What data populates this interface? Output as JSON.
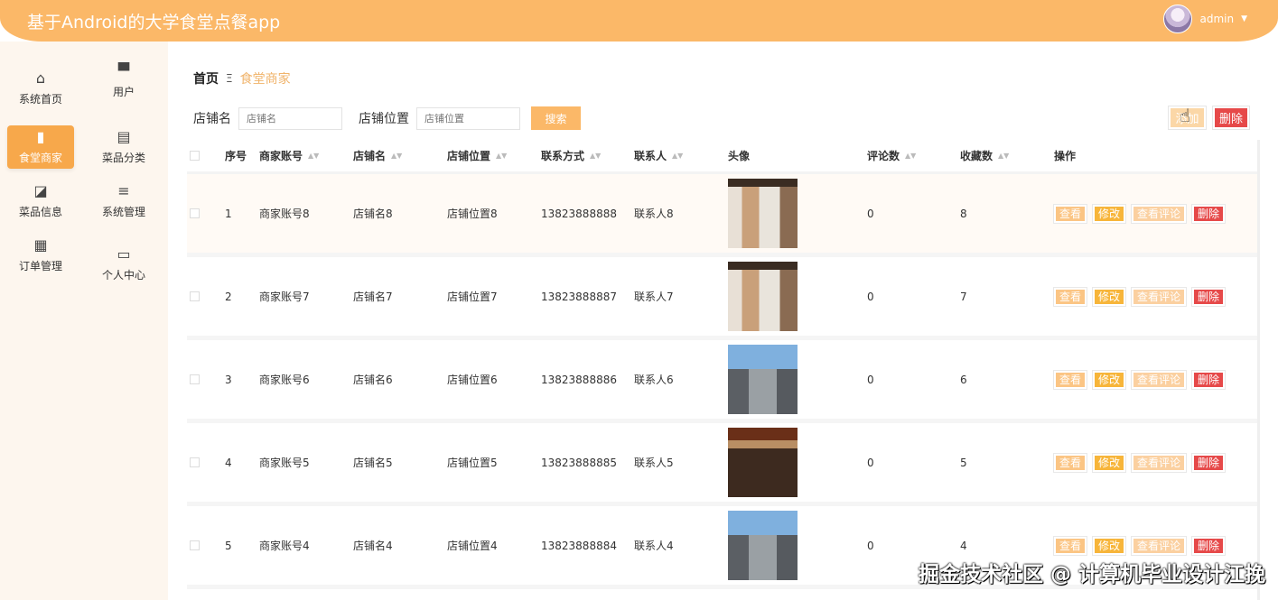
{
  "header": {
    "title": "基于Android的大学食堂点餐app",
    "user": "admin"
  },
  "sidebar": {
    "items": [
      {
        "label": "系统首页",
        "icon": "home-icon"
      },
      {
        "label": "用户",
        "icon": "store-icon"
      },
      {
        "label": "食堂商家",
        "icon": "book-icon",
        "active": true
      },
      {
        "label": "菜品分类",
        "icon": "clipboard-icon"
      },
      {
        "label": "菜品信息",
        "icon": "chart-icon"
      },
      {
        "label": "系统管理",
        "icon": "sliders-icon"
      },
      {
        "label": "订单管理",
        "icon": "grid-icon"
      },
      {
        "label": "个人中心",
        "icon": "card-icon"
      }
    ]
  },
  "breadcrumb": {
    "home": "首页",
    "separator": "Ξ",
    "current": "食堂商家"
  },
  "search": {
    "shop_name_label": "店铺名",
    "shop_name_placeholder": "店铺名",
    "location_label": "店铺位置",
    "location_placeholder": "店铺位置",
    "button": "搜索"
  },
  "actions": {
    "add": "添加",
    "delete": "删除"
  },
  "table": {
    "columns": [
      "序号",
      "商家账号",
      "店铺名",
      "店铺位置",
      "联系方式",
      "联系人",
      "头像",
      "评论数",
      "收藏数",
      "操作"
    ],
    "rows": [
      {
        "index": "1",
        "account": "商家账号8",
        "name": "店铺名8",
        "location": "店铺位置8",
        "phone": "13823888888",
        "contact": "联系人8",
        "image": "shop-counter",
        "comments": "0",
        "favorites": "8"
      },
      {
        "index": "2",
        "account": "商家账号7",
        "name": "店铺名7",
        "location": "店铺位置7",
        "phone": "13823888887",
        "contact": "联系人7",
        "image": "shop-counter",
        "comments": "0",
        "favorites": "7"
      },
      {
        "index": "3",
        "account": "商家账号6",
        "name": "店铺名6",
        "location": "店铺位置6",
        "phone": "13823888886",
        "contact": "联系人6",
        "image": "building",
        "comments": "0",
        "favorites": "6"
      },
      {
        "index": "4",
        "account": "商家账号5",
        "name": "店铺名5",
        "location": "店铺位置5",
        "phone": "13823888885",
        "contact": "联系人5",
        "image": "storefront",
        "comments": "0",
        "favorites": "5"
      },
      {
        "index": "5",
        "account": "商家账号4",
        "name": "店铺名4",
        "location": "店铺位置4",
        "phone": "13823888884",
        "contact": "联系人4",
        "image": "building",
        "comments": "0",
        "favorites": "4"
      }
    ],
    "row_actions": {
      "view": "查看",
      "edit": "修改",
      "comments": "查看评论",
      "delete": "删除"
    }
  },
  "watermark": "掘金技术社区 @ 计算机毕业设计江挽",
  "colors": {
    "primary": "#fbb868",
    "active": "#f7a84b",
    "danger": "#e64949"
  }
}
